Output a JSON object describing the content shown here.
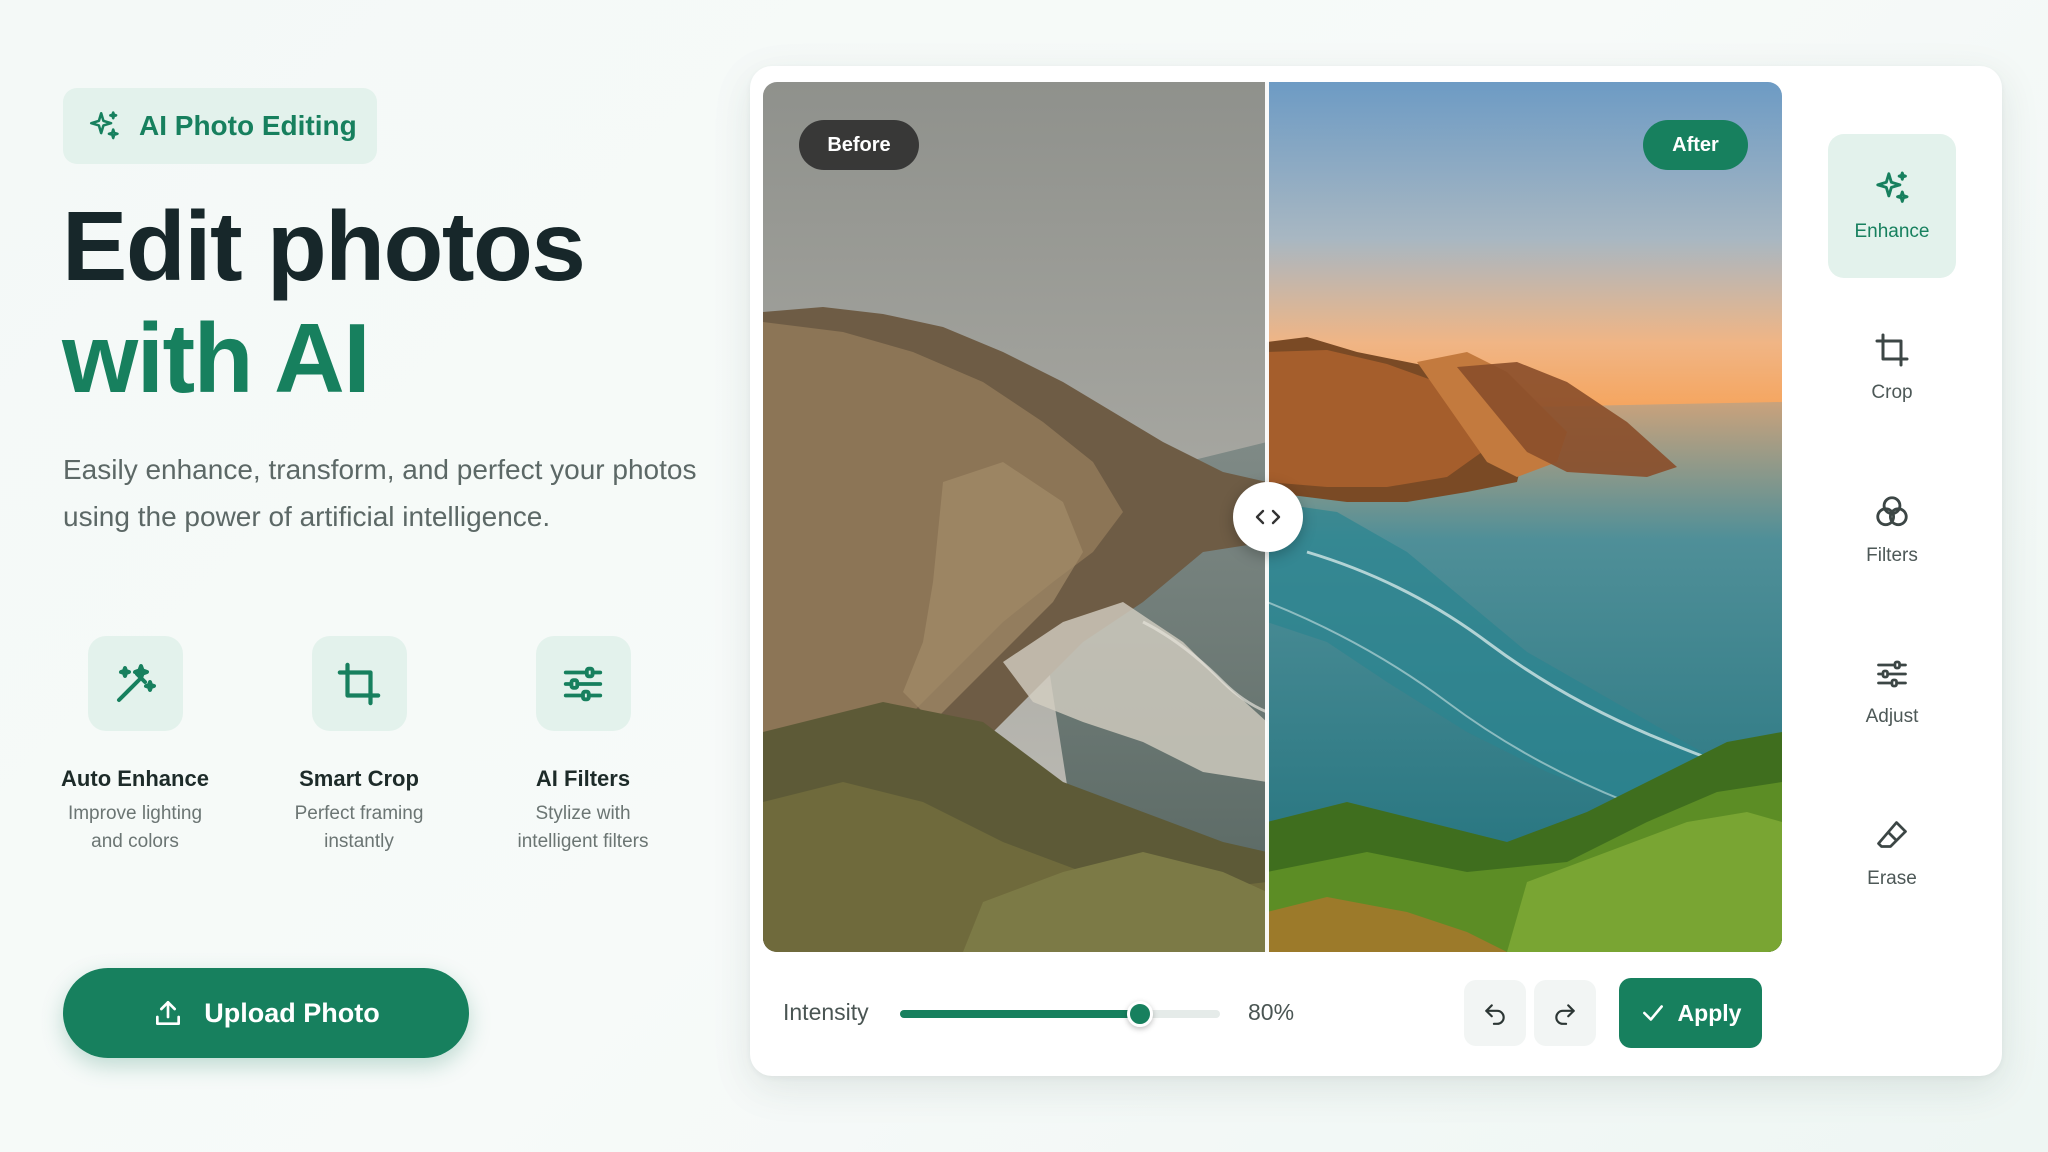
{
  "badge": {
    "label": "AI Photo Editing"
  },
  "headline": {
    "line1": "Edit photos",
    "line2": "with AI"
  },
  "subheading": "Easily enhance, transform, and perfect your photos using the power of artificial intelligence.",
  "features": [
    {
      "title": "Auto Enhance",
      "desc_line1": "Improve lighting",
      "desc_line2": "and colors",
      "icon": "magic-wand-icon"
    },
    {
      "title": "Smart Crop",
      "desc_line1": "Perfect framing",
      "desc_line2": "instantly",
      "icon": "crop-icon"
    },
    {
      "title": "AI Filters",
      "desc_line1": "Stylize with",
      "desc_line2": "intelligent filters",
      "icon": "sliders-icon"
    }
  ],
  "upload_button": {
    "label": "Upload Photo",
    "icon": "upload-icon"
  },
  "editor": {
    "before_label": "Before",
    "after_label": "After",
    "tools": [
      {
        "label": "Enhance",
        "icon": "sparkles-icon",
        "active": true
      },
      {
        "label": "Crop",
        "icon": "crop-icon",
        "active": false
      },
      {
        "label": "Filters",
        "icon": "filters-icon",
        "active": false
      },
      {
        "label": "Adjust",
        "icon": "sliders-icon",
        "active": false
      },
      {
        "label": "Erase",
        "icon": "eraser-icon",
        "active": false
      }
    ],
    "intensity_label": "Intensity",
    "intensity_value": "80%",
    "intensity_fraction": 0.75,
    "undo_icon": "undo-icon",
    "redo_icon": "redo-icon",
    "apply_label": "Apply"
  },
  "colors": {
    "accent": "#17805e",
    "accent_soft": "#e3f2ec",
    "heading": "#17272a"
  }
}
